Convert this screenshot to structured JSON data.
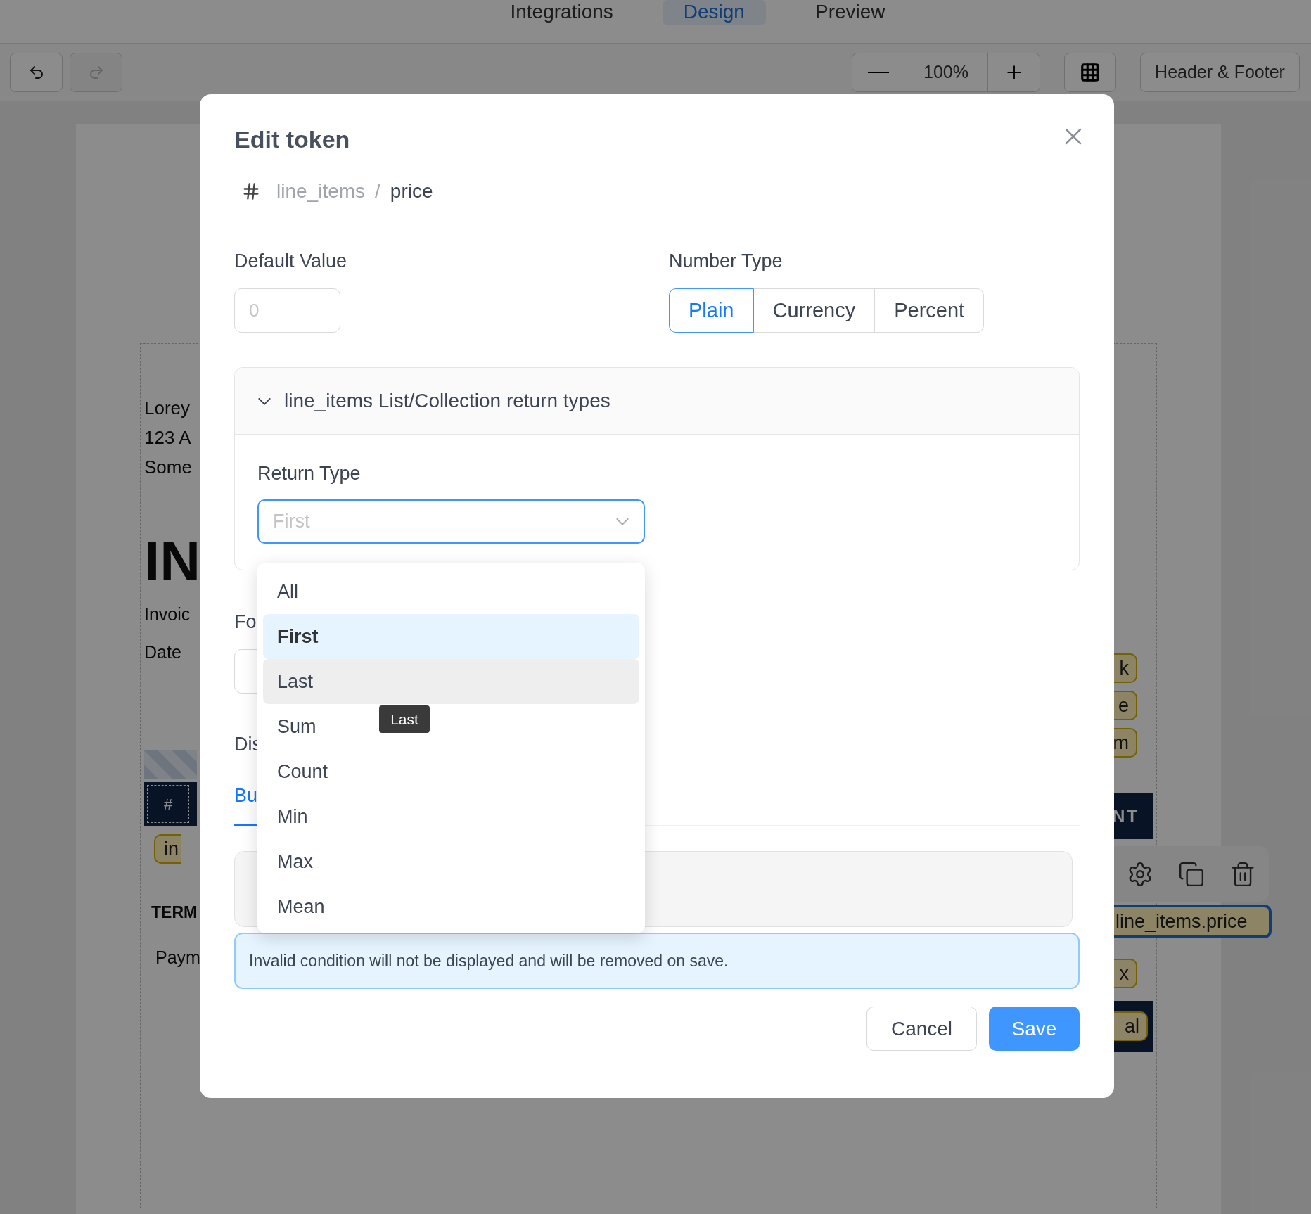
{
  "top_tabs": [
    {
      "label": "Integrations",
      "selected": false
    },
    {
      "label": "Design",
      "selected": true
    },
    {
      "label": "Preview",
      "selected": false
    }
  ],
  "toolbar": {
    "undo_disabled": false,
    "redo_disabled": true,
    "zoom": "100%",
    "header_footer": "Header & Footer"
  },
  "document": {
    "address_lines": [
      "Lorey",
      "123 A",
      "Some"
    ],
    "heading": "IN",
    "meta_labels": [
      "Invoic",
      "Date"
    ],
    "table_header_cell": "#",
    "item_pill": "in",
    "terms_title": "TERM",
    "terms_text": "Paym",
    "right_pills": [
      "k",
      "e",
      "m"
    ],
    "right_header_cell": "NT",
    "right_pill": "x",
    "total_pill": "al",
    "selected_token": "line_items.price"
  },
  "dialog": {
    "title": "Edit token",
    "breadcrumb": {
      "parent": "line_items",
      "separator": "/",
      "current": "price"
    },
    "default_value": {
      "label": "Default Value",
      "placeholder": "0"
    },
    "number_type": {
      "label": "Number Type",
      "options": [
        {
          "label": "Plain",
          "selected": true
        },
        {
          "label": "Currency",
          "selected": false
        },
        {
          "label": "Percent",
          "selected": false
        }
      ]
    },
    "collapse": {
      "title": "line_items List/Collection return types",
      "expanded": true,
      "return_type": {
        "label": "Return Type",
        "placeholder": "First",
        "open": true,
        "options": [
          {
            "label": "All",
            "selected": false,
            "hovered": false
          },
          {
            "label": "First",
            "selected": true,
            "hovered": false
          },
          {
            "label": "Last",
            "selected": false,
            "hovered": true
          },
          {
            "label": "Sum",
            "selected": false,
            "hovered": false
          },
          {
            "label": "Count",
            "selected": false,
            "hovered": false
          },
          {
            "label": "Min",
            "selected": false,
            "hovered": false
          },
          {
            "label": "Max",
            "selected": false,
            "hovered": false
          },
          {
            "label": "Mean",
            "selected": false,
            "hovered": false
          }
        ]
      }
    },
    "tooltip": "Last",
    "format_label": "Fo",
    "display_label": "Dis",
    "tabs": [
      {
        "label": "Bu",
        "selected": true
      }
    ],
    "alert": "Invalid condition will not be displayed and will be removed on save.",
    "buttons": {
      "cancel": "Cancel",
      "save": "Save"
    }
  }
}
